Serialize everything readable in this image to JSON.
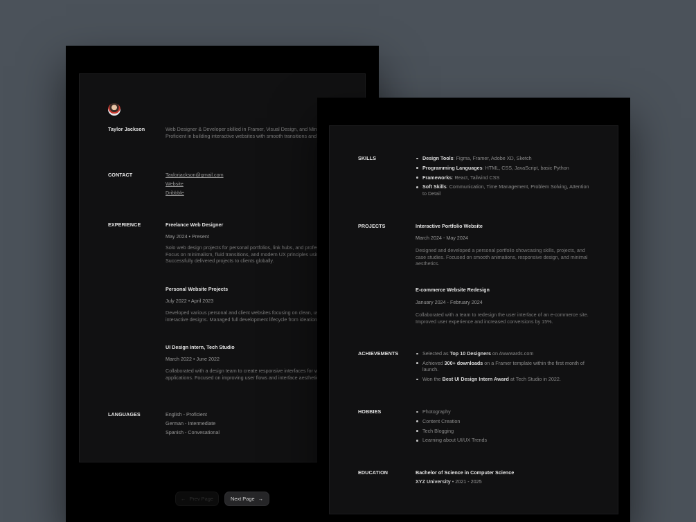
{
  "page1": {
    "name": "Taylor Jackson",
    "intro": "Web Designer & Developer skilled in Framer, Visual Design, and Minimalistic Aesthetics. Proficient in building interactive websites with smooth transitions and responsive design.",
    "contact": {
      "heading": "CONTACT",
      "email": "Taylorjackson@gmail.com",
      "website": "Website",
      "dribbble": "Dribbble"
    },
    "experience": {
      "heading": "EXPERIENCE",
      "items": [
        {
          "title": "Freelance Web Designer",
          "date": "May 2024 • Present",
          "desc": "Solo web design projects for personal portfolios, link hubs, and professional websites. Focus on minimalism, fluid transitions, and modern UX principles using Framer and Figma. Successfully delivered projects to clients globally."
        },
        {
          "title": "Personal Website Projects",
          "date": "July 2022 • April 2023",
          "desc": "Developed various personal and client websites focusing on clean, user-friendly, and interactive designs. Managed full development lifecycle from ideation to deployment."
        },
        {
          "title": "UI Design Intern, Tech Studio",
          "date": "March 2022 • June 2022",
          "desc": "Collaborated with a design team to create responsive interfaces for web and mobile applications. Focused on improving user flows and interface aesthetics."
        }
      ]
    },
    "languages": {
      "heading": "LANGUAGES",
      "items": [
        "English - Proficient",
        "German - Intermediate",
        "Spanish - Convesational"
      ]
    },
    "pager": {
      "prev": "Prev Page",
      "next": "Next Page"
    }
  },
  "page2": {
    "skills": {
      "heading": "SKILLS",
      "items": [
        {
          "label": "Design Tools",
          "text": ": Figma, Framer, Adobe XD, Sketch"
        },
        {
          "label": "Programming Languages",
          "text": ": HTML, CSS, JavaScript, basic Python"
        },
        {
          "label": "Frameworks",
          "text": ": React, Tailwind CSS"
        },
        {
          "label": "Soft Skills",
          "text": ": Communication, Time Management, Problem Solving, Attention to Detail"
        }
      ]
    },
    "projects": {
      "heading": "PROJECTS",
      "items": [
        {
          "title": "Interactive Portfolio Website",
          "date": "March 2024 - May 2024",
          "desc": "Designed and developed a personal portfolio showcasing skills, projects, and case studies. Focused on smooth animations, responsive design, and minimal aesthetics."
        },
        {
          "title": "E-commerce Website Redesign",
          "date": "January 2024 - February 2024",
          "desc": "Collaborated with a team to redesign the user interface of an e-commerce site. Improved user experience and increased conversions by 15%."
        }
      ]
    },
    "achievements": {
      "heading": "ACHIEVEMENTS",
      "items": [
        {
          "pre": "Selected as ",
          "bold": "Top 10 Designers",
          "post": " on Awwwards.com"
        },
        {
          "pre": "Achieved ",
          "bold": "300+ downloads",
          "post": " on a Framer template within the first month of launch."
        },
        {
          "pre": "Won the ",
          "bold": "Best UI Design Intern Award",
          "post": " at Tech Studio in 2022."
        }
      ]
    },
    "hobbies": {
      "heading": "HOBBIES",
      "items": [
        "Photography",
        "Content Creation",
        "Tech Blogging",
        "Learning about UI/UX Trends"
      ]
    },
    "education": {
      "heading": "EDUCATION",
      "degree": "Bachelor of Science in Computer Science",
      "school": "XYZ University",
      "years": " • 2021 - 2025"
    }
  }
}
